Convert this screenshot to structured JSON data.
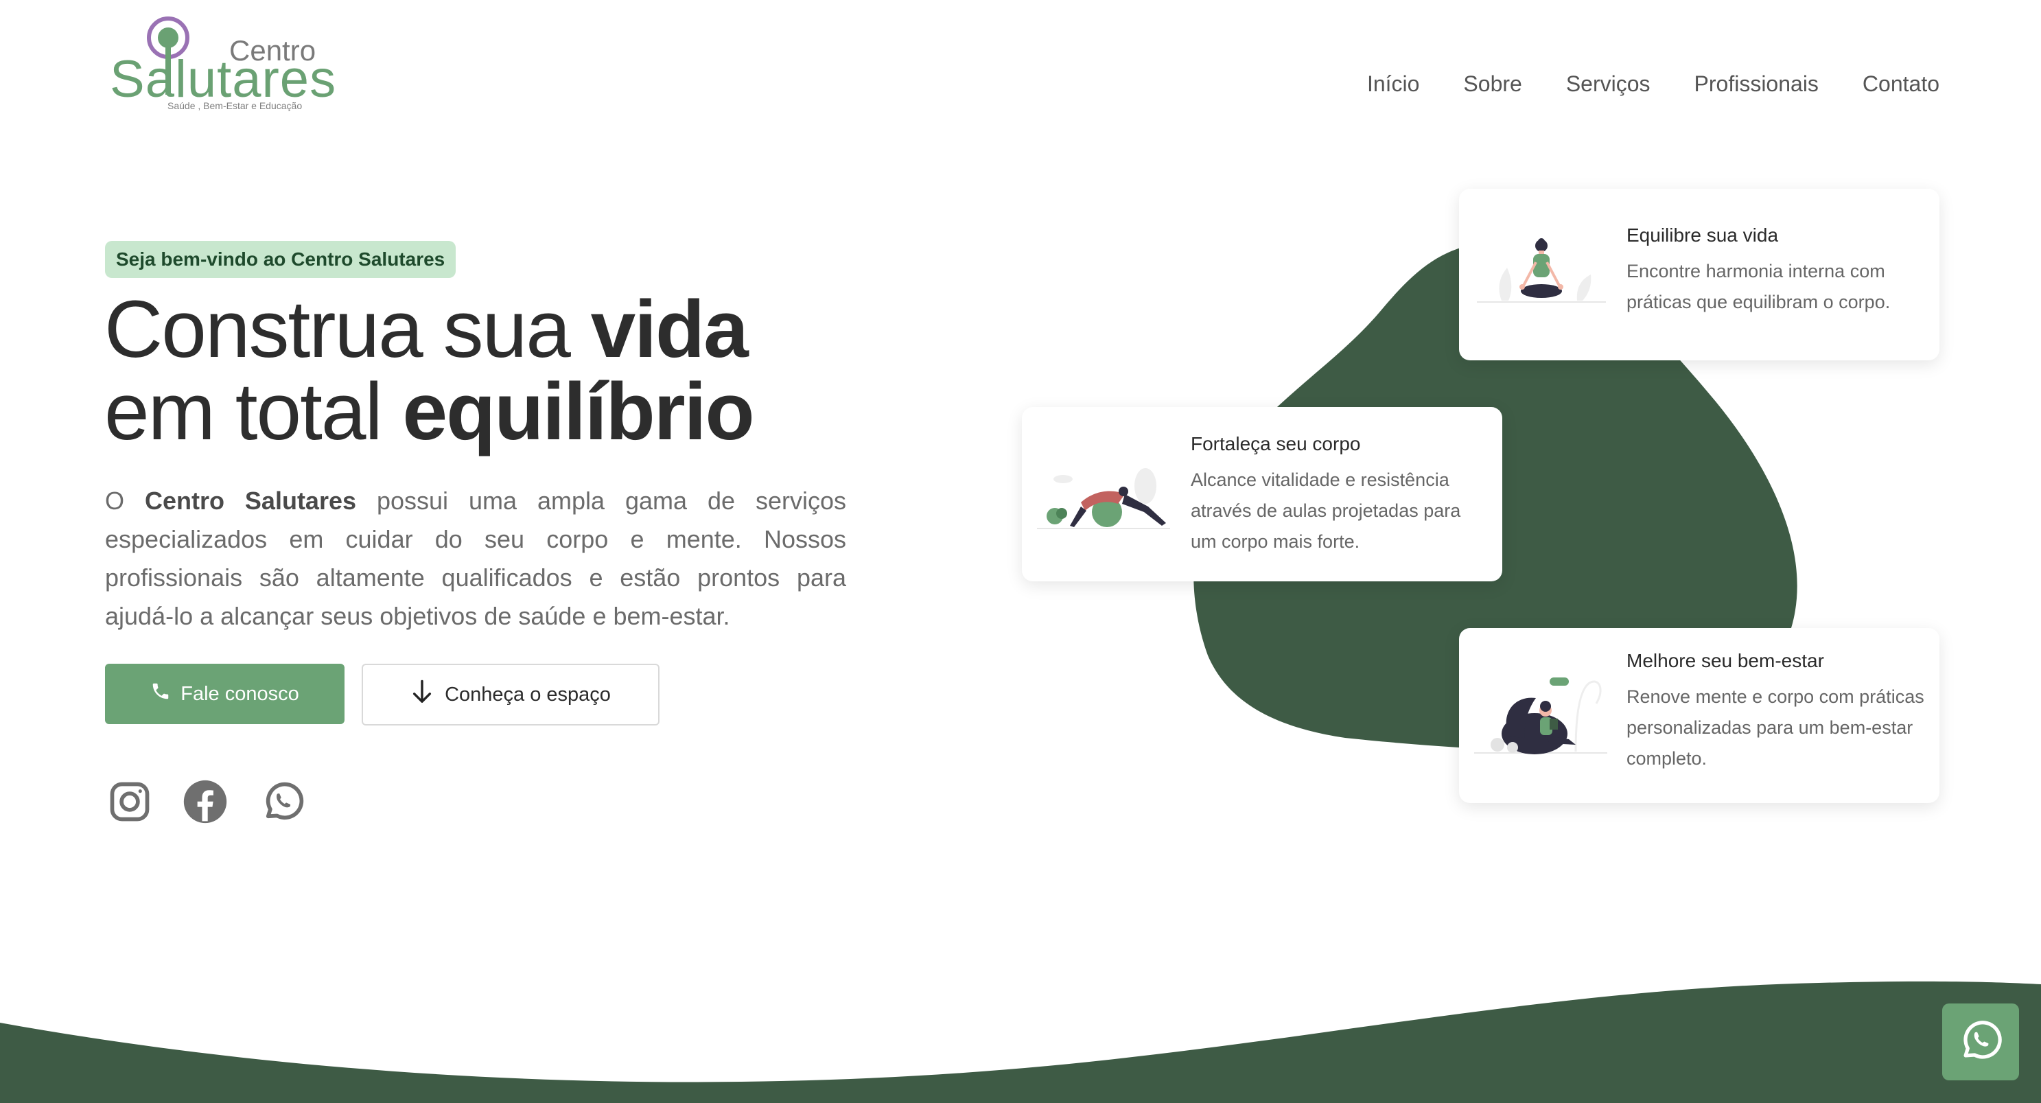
{
  "logo": {
    "top": "Centro",
    "name": "Salutares",
    "tagline": "Saúde , Bem-Estar e Educação"
  },
  "nav": [
    "Início",
    "Sobre",
    "Serviços",
    "Profissionais",
    "Contato"
  ],
  "hero": {
    "badge": "Seja bem-vindo ao Centro Salutares",
    "headline_line1_regular": "Construa sua ",
    "headline_line1_bold": "vida",
    "headline_line2_regular": "em total ",
    "headline_line2_bold": "equilíbrio",
    "lead_prefix": "O ",
    "lead_brand": "Centro Salutares",
    "lead_rest": " possui uma ampla gama de serviços especializados em cuidar do seu corpo e mente. Nossos profissionais são altamente qualificados e estão prontos para ajudá-lo a alcançar seus objetivos de saúde e bem-estar.",
    "cta_primary": "Fale conosco",
    "cta_secondary": "Conheça o espaço"
  },
  "cards": [
    {
      "title": "Equilibre sua vida",
      "desc": "Encontre harmonia interna com práticas que equilibram o corpo."
    },
    {
      "title": "Fortaleça seu corpo",
      "desc": "Alcance vitalidade e resistência através de aulas projetadas para um corpo mais forte."
    },
    {
      "title": "Melhore seu bem-estar",
      "desc": "Renove mente e corpo com práticas personalizadas para um bem-estar completo."
    }
  ],
  "colors": {
    "brand_green": "#6ba375",
    "dark_green": "#3e5b45",
    "badge_bg": "#c8e7ce",
    "logo_purple": "#9a72b4"
  },
  "icons": [
    "phone-icon",
    "arrow-down-icon",
    "instagram-icon",
    "facebook-icon",
    "whatsapp-icon"
  ]
}
